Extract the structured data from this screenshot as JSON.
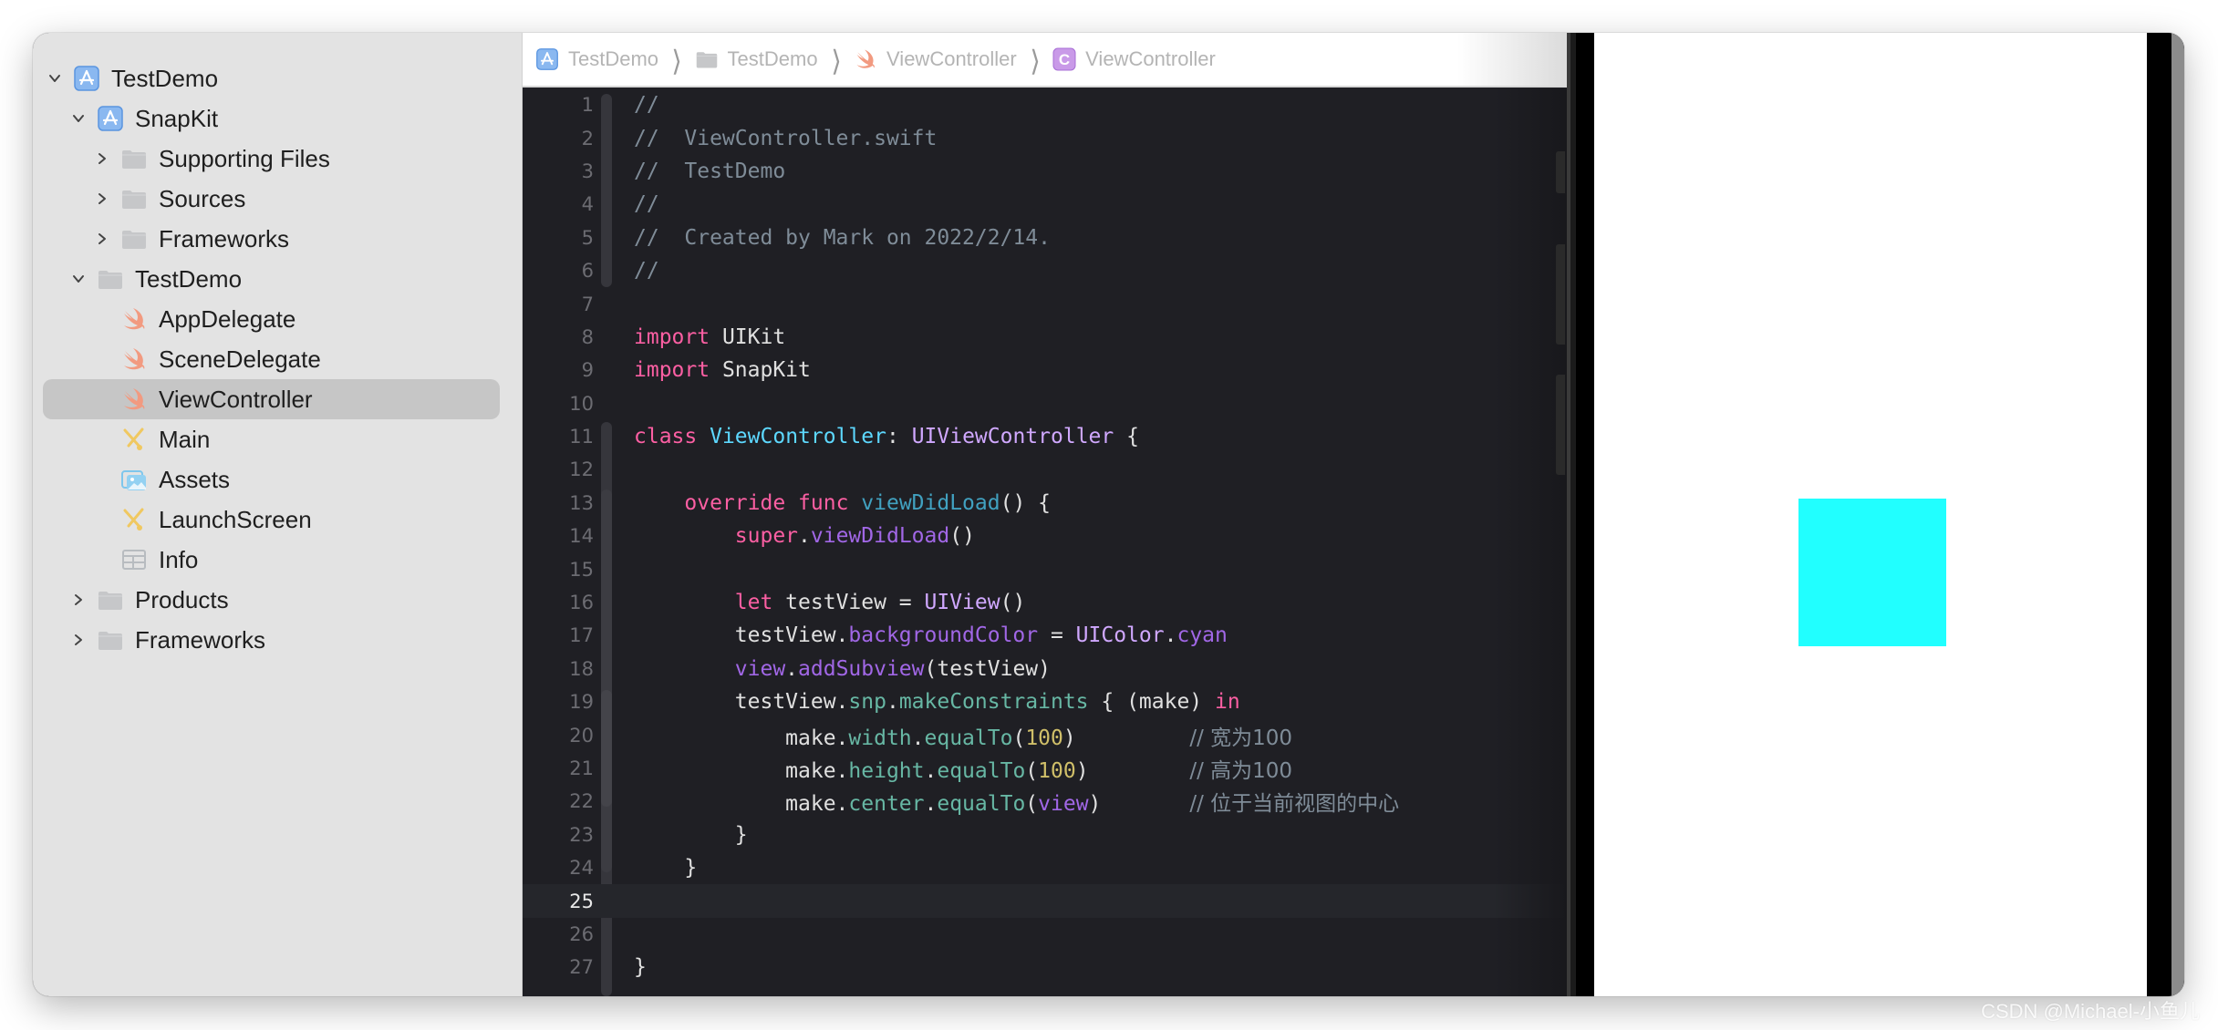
{
  "sidebar": {
    "items": [
      {
        "label": "TestDemo",
        "level": 0,
        "chevron": "down",
        "icon": "app-project-icon",
        "selected": false
      },
      {
        "label": "SnapKit",
        "level": 1,
        "chevron": "down",
        "icon": "app-project-icon",
        "selected": false
      },
      {
        "label": "Supporting Files",
        "level": 2,
        "chevron": "right",
        "icon": "folder-icon",
        "selected": false
      },
      {
        "label": "Sources",
        "level": 2,
        "chevron": "right",
        "icon": "folder-icon",
        "selected": false
      },
      {
        "label": "Frameworks",
        "level": 2,
        "chevron": "right",
        "icon": "folder-icon",
        "selected": false
      },
      {
        "label": "TestDemo",
        "level": 1,
        "chevron": "down",
        "icon": "folder-icon",
        "selected": false
      },
      {
        "label": "AppDelegate",
        "level": 2,
        "chevron": "none",
        "icon": "swift-icon",
        "selected": false
      },
      {
        "label": "SceneDelegate",
        "level": 2,
        "chevron": "none",
        "icon": "swift-icon",
        "selected": false
      },
      {
        "label": "ViewController",
        "level": 2,
        "chevron": "none",
        "icon": "swift-icon",
        "selected": true
      },
      {
        "label": "Main",
        "level": 2,
        "chevron": "none",
        "icon": "storyboard-icon",
        "selected": false
      },
      {
        "label": "Assets",
        "level": 2,
        "chevron": "none",
        "icon": "assets-icon",
        "selected": false
      },
      {
        "label": "LaunchScreen",
        "level": 2,
        "chevron": "none",
        "icon": "storyboard-icon",
        "selected": false
      },
      {
        "label": "Info",
        "level": 2,
        "chevron": "none",
        "icon": "plist-icon",
        "selected": false
      },
      {
        "label": "Products",
        "level": 1,
        "chevron": "right",
        "icon": "folder-icon",
        "selected": false
      },
      {
        "label": "Frameworks",
        "level": 1,
        "chevron": "right",
        "icon": "folder-icon",
        "selected": false
      }
    ]
  },
  "breadcrumb": [
    {
      "label": "TestDemo",
      "icon": "app-project-icon"
    },
    {
      "label": "TestDemo",
      "icon": "folder-icon"
    },
    {
      "label": "ViewController",
      "icon": "swift-icon"
    },
    {
      "label": "ViewController",
      "icon": "class-icon",
      "badge": "C"
    }
  ],
  "editor": {
    "current_line": 25,
    "lines": [
      [
        {
          "t": "//",
          "c": "comment"
        }
      ],
      [
        {
          "t": "//  ViewController.swift",
          "c": "comment"
        }
      ],
      [
        {
          "t": "//  TestDemo",
          "c": "comment"
        }
      ],
      [
        {
          "t": "//",
          "c": "comment"
        }
      ],
      [
        {
          "t": "//  Created by Mark on 2022/2/14.",
          "c": "comment"
        }
      ],
      [
        {
          "t": "//",
          "c": "comment"
        }
      ],
      [],
      [
        {
          "t": "import",
          "c": "kw"
        },
        {
          "t": " UIKit",
          "c": "plain"
        }
      ],
      [
        {
          "t": "import",
          "c": "kw"
        },
        {
          "t": " SnapKit",
          "c": "plain"
        }
      ],
      [],
      [
        {
          "t": "class",
          "c": "kw"
        },
        {
          "t": " ",
          "c": "plain"
        },
        {
          "t": "ViewController",
          "c": "type-decl"
        },
        {
          "t": ": ",
          "c": "plain"
        },
        {
          "t": "UIViewController",
          "c": "type"
        },
        {
          "t": " {",
          "c": "plain"
        }
      ],
      [],
      [
        {
          "t": "    ",
          "c": "plain"
        },
        {
          "t": "override",
          "c": "kw"
        },
        {
          "t": " ",
          "c": "plain"
        },
        {
          "t": "func",
          "c": "kw"
        },
        {
          "t": " ",
          "c": "plain"
        },
        {
          "t": "viewDidLoad",
          "c": "func-decl"
        },
        {
          "t": "() {",
          "c": "plain"
        }
      ],
      [
        {
          "t": "        ",
          "c": "plain"
        },
        {
          "t": "super",
          "c": "kw"
        },
        {
          "t": ".",
          "c": "plain"
        },
        {
          "t": "viewDidLoad",
          "c": "method"
        },
        {
          "t": "()",
          "c": "plain"
        }
      ],
      [],
      [
        {
          "t": "        ",
          "c": "plain"
        },
        {
          "t": "let",
          "c": "kw"
        },
        {
          "t": " testView = ",
          "c": "plain"
        },
        {
          "t": "UIView",
          "c": "type"
        },
        {
          "t": "()",
          "c": "plain"
        }
      ],
      [
        {
          "t": "        testView.",
          "c": "plain"
        },
        {
          "t": "backgroundColor",
          "c": "method"
        },
        {
          "t": " = ",
          "c": "plain"
        },
        {
          "t": "UIColor",
          "c": "type"
        },
        {
          "t": ".",
          "c": "plain"
        },
        {
          "t": "cyan",
          "c": "method"
        }
      ],
      [
        {
          "t": "        ",
          "c": "plain"
        },
        {
          "t": "view",
          "c": "method"
        },
        {
          "t": ".",
          "c": "plain"
        },
        {
          "t": "addSubview",
          "c": "method"
        },
        {
          "t": "(testView)",
          "c": "plain"
        }
      ],
      [
        {
          "t": "        testView.",
          "c": "plain"
        },
        {
          "t": "snp",
          "c": "proj"
        },
        {
          "t": ".",
          "c": "plain"
        },
        {
          "t": "makeConstraints",
          "c": "proj"
        },
        {
          "t": " { (make) ",
          "c": "plain"
        },
        {
          "t": "in",
          "c": "kw"
        }
      ],
      [
        {
          "t": "            make.",
          "c": "plain"
        },
        {
          "t": "width",
          "c": "proj"
        },
        {
          "t": ".",
          "c": "plain"
        },
        {
          "t": "equalTo",
          "c": "proj"
        },
        {
          "t": "(",
          "c": "plain"
        },
        {
          "t": "100",
          "c": "num"
        },
        {
          "t": ")         ",
          "c": "plain"
        },
        {
          "t": "// 宽为100",
          "c": "comment"
        }
      ],
      [
        {
          "t": "            make.",
          "c": "plain"
        },
        {
          "t": "height",
          "c": "proj"
        },
        {
          "t": ".",
          "c": "plain"
        },
        {
          "t": "equalTo",
          "c": "proj"
        },
        {
          "t": "(",
          "c": "plain"
        },
        {
          "t": "100",
          "c": "num"
        },
        {
          "t": ")        ",
          "c": "plain"
        },
        {
          "t": "// 高为100",
          "c": "comment"
        }
      ],
      [
        {
          "t": "            make.",
          "c": "plain"
        },
        {
          "t": "center",
          "c": "proj"
        },
        {
          "t": ".",
          "c": "plain"
        },
        {
          "t": "equalTo",
          "c": "proj"
        },
        {
          "t": "(",
          "c": "plain"
        },
        {
          "t": "view",
          "c": "method"
        },
        {
          "t": ")       ",
          "c": "plain"
        },
        {
          "t": "// 位于当前视图的中心",
          "c": "comment"
        }
      ],
      [
        {
          "t": "        }",
          "c": "plain"
        }
      ],
      [
        {
          "t": "    }",
          "c": "plain"
        }
      ],
      [],
      [],
      [
        {
          "t": "}",
          "c": "plain"
        }
      ]
    ]
  },
  "simulator": {
    "screen_bg": "#ffffff",
    "view_color": "#21ffff",
    "view_label": "testView (cyan 100×100, centered)"
  },
  "colors": {
    "sidebar_bg": "#e3e3e3",
    "editor_bg": "#1f1f24",
    "keyword": "#fc5fa3",
    "comment": "#7f8c98",
    "type_decl": "#5dd8ff",
    "type": "#d0a8ff",
    "project": "#67b7a4",
    "number": "#d0bf69",
    "swift_orange": "#f0866a"
  },
  "watermark": "CSDN @Michael-小鱼儿"
}
